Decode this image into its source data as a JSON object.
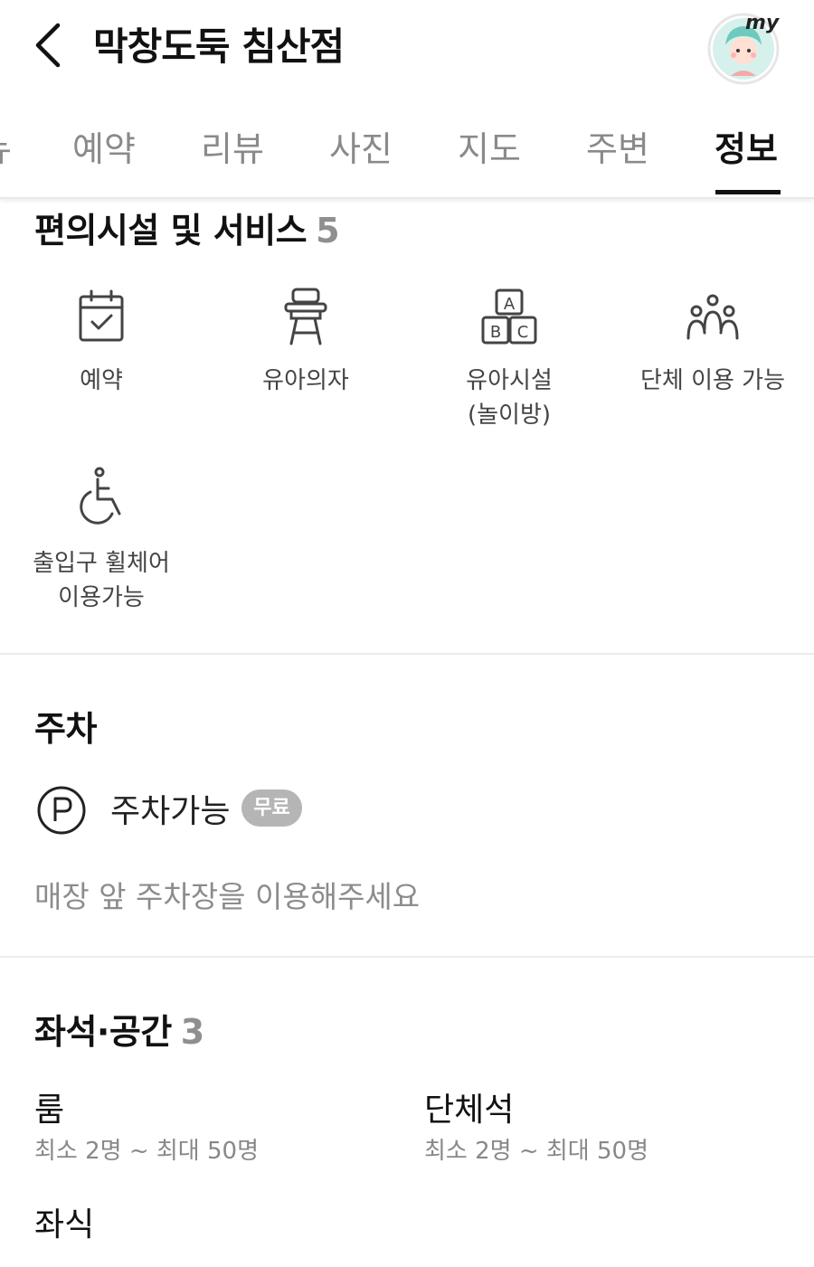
{
  "header": {
    "title": "막창도둑 침산점",
    "avatar_badge": "my"
  },
  "tabs": [
    {
      "label": "뉴"
    },
    {
      "label": "예약"
    },
    {
      "label": "리뷰"
    },
    {
      "label": "사진"
    },
    {
      "label": "지도"
    },
    {
      "label": "주변"
    },
    {
      "label": "정보"
    }
  ],
  "active_tab": "정보",
  "facilities": {
    "title": "편의시설 및 서비스",
    "count": "5",
    "items": [
      {
        "label": "예약",
        "icon": "calendar-check-icon"
      },
      {
        "label": "유아의자",
        "icon": "high-chair-icon"
      },
      {
        "label": "유아시설\n(놀이방)",
        "icon": "abc-blocks-icon"
      },
      {
        "label": "단체 이용 가능",
        "icon": "group-icon"
      },
      {
        "label": "출입구 휠체어\n이용가능",
        "icon": "wheelchair-icon"
      }
    ]
  },
  "parking": {
    "title": "주차",
    "status": "주차가능",
    "badge": "무료",
    "note": "매장 앞 주차장을 이용해주세요"
  },
  "seating": {
    "title": "좌석·공간",
    "count": "3",
    "items": [
      {
        "name": "룸",
        "capacity": "최소 2명 ~ 최대 50명"
      },
      {
        "name": "단체석",
        "capacity": "최소 2명 ~ 최대 50명"
      },
      {
        "name": "좌식"
      }
    ]
  },
  "colors": {
    "text": "#111111",
    "muted": "#8a8a8a",
    "badge": "#b5b5b5",
    "avatar_bg": "#d6f1ec"
  }
}
